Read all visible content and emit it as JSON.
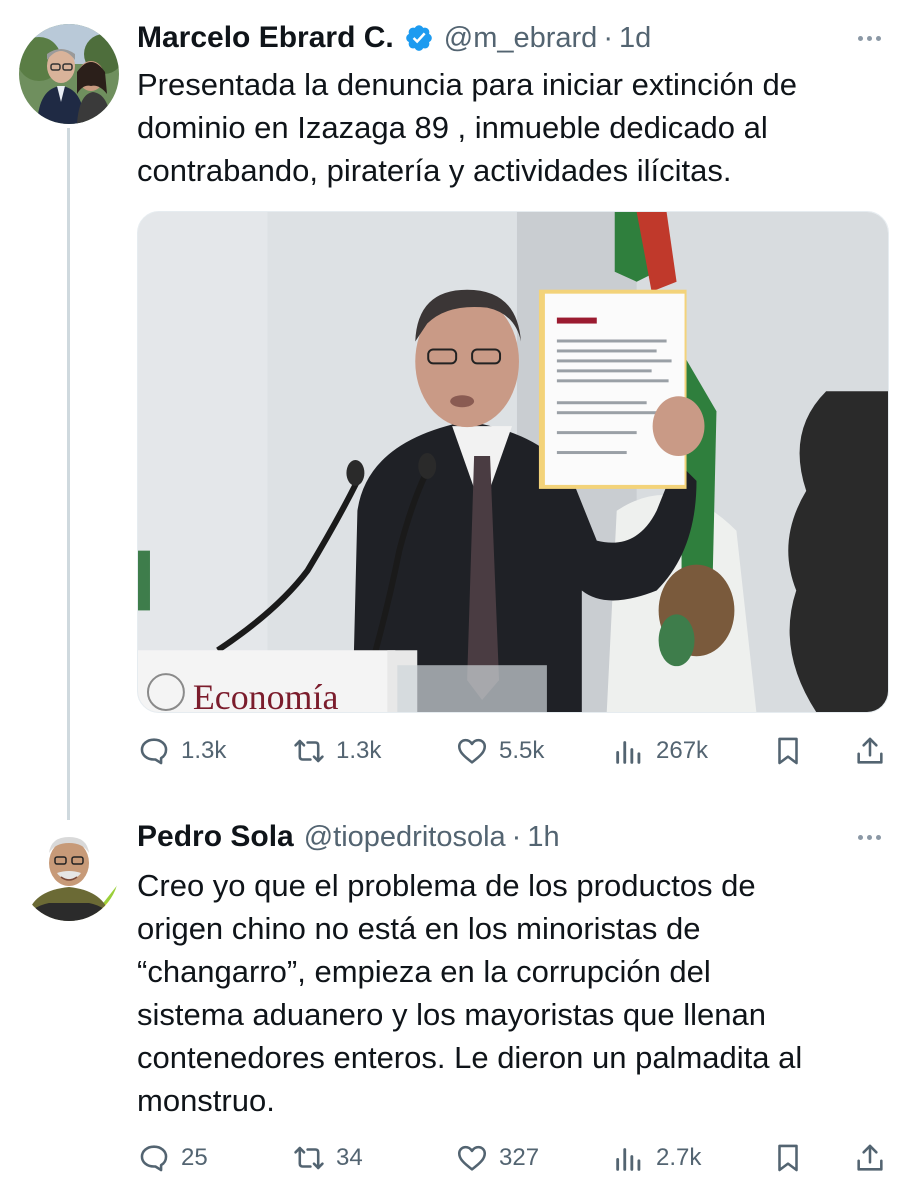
{
  "tweets": [
    {
      "display_name": "Marcelo Ebrard C.",
      "verified": true,
      "handle": "@m_ebrard",
      "separator": "·",
      "time": "1d",
      "text": "Presentada la denuncia para iniciar extinción de\ndominio en Izazaga  89 , inmueble dedicado al\ncontrabando, piratería y actividades ilícitas.",
      "media": {
        "podium_text": "Economía"
      },
      "stats": {
        "replies": "1.3k",
        "retweets": "1.3k",
        "likes": "5.5k",
        "views": "267k"
      }
    },
    {
      "display_name": "Pedro Sola",
      "verified": false,
      "handle": "@tiopedritosola",
      "separator": "·",
      "time": "1h",
      "text": "Creo yo que el problema de los productos de\norigen chino no está en los minoristas de\n“changarro”, empieza en la corrupción del\nsistema aduanero y los mayoristas que llenan\ncontenedores enteros. Le dieron un palmadita al\nmonstruo.",
      "stats": {
        "replies": "25",
        "retweets": "34",
        "likes": "327",
        "views": "2.7k"
      }
    }
  ],
  "colors": {
    "text": "#0f1419",
    "secondary": "#536471",
    "verified_blue": "#1d9bf0",
    "thread_line": "#cfd9de"
  },
  "icons": [
    "reply-icon",
    "retweet-icon",
    "like-icon",
    "views-icon",
    "bookmark-icon",
    "share-icon",
    "more-icon",
    "verified-badge-icon"
  ]
}
